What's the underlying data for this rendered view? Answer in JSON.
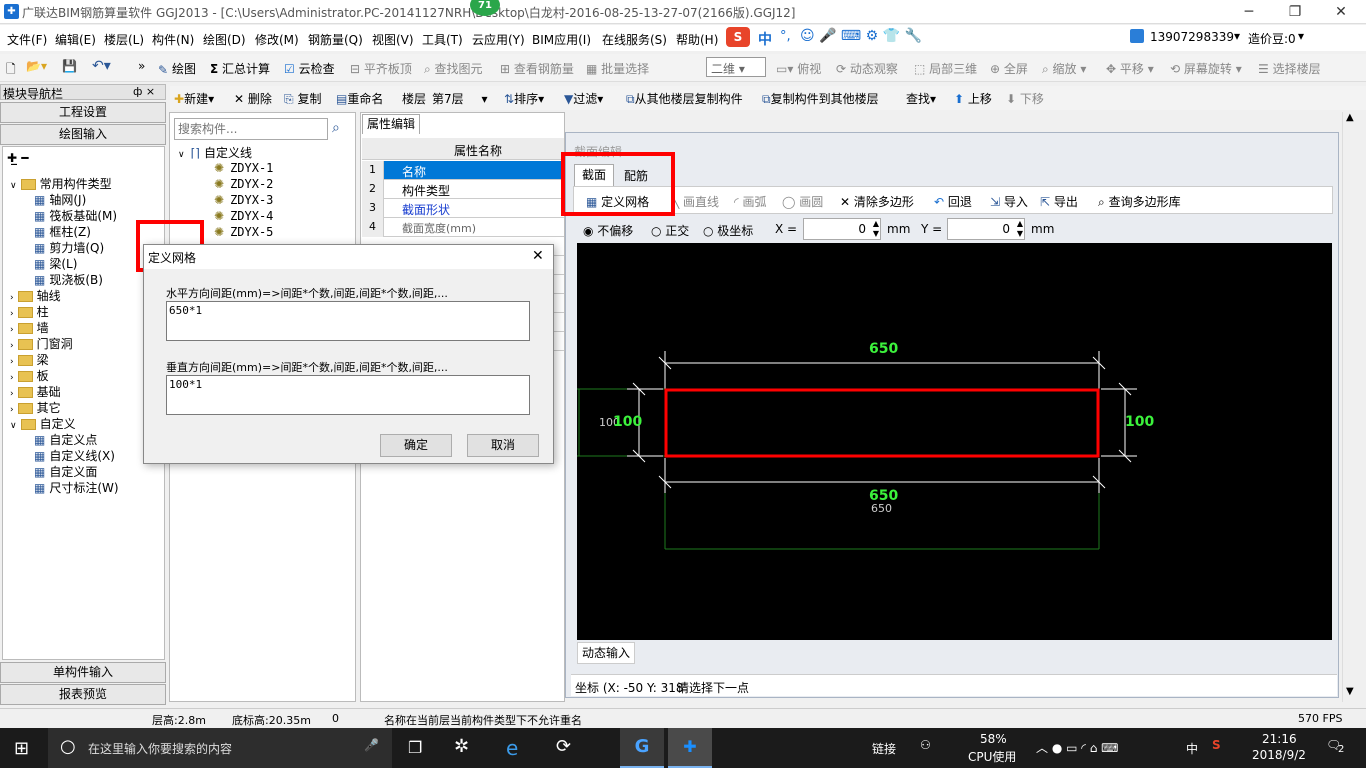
{
  "window": {
    "title": "广联达BIM钢筋算量软件 GGJ2013 - [C:\\Users\\Administrator.PC-20141127NRH\\Desktop\\白龙村-2016-08-25-13-27-07(2166版).GGJ12]",
    "badge": "71",
    "minimize": "─",
    "restore": "❐",
    "close": "✕"
  },
  "menu": [
    "文件(F)",
    "编辑(E)",
    "楼层(L)",
    "构件(N)",
    "绘图(D)",
    "修改(M)",
    "钢筋量(Q)",
    "视图(V)",
    "工具(T)",
    "云应用(Y)",
    "BIM应用(I)",
    "在线服务(S)",
    "帮助(H)"
  ],
  "ime": {
    "lang": "中",
    "extra": "°,"
  },
  "user": {
    "phone": "13907298339",
    "bean": "造价豆:0"
  },
  "toolbar1": {
    "draw": "绘图",
    "sum": "汇总计算",
    "cloud_check": "云检查",
    "flat_top": "平齐板顶",
    "find_elem": "查找图元",
    "view_rebar": "查看钢筋量",
    "batch_select": "批量选择",
    "view_mode": "二维",
    "top_view": "俯视",
    "dynamic_view": "动态观察",
    "local_3d": "局部三维",
    "fullscreen": "全屏",
    "zoom": "缩放",
    "pan": "平移",
    "screen_rotate": "屏幕旋转",
    "select_floor": "选择楼层"
  },
  "toolbar2": {
    "new": "新建",
    "delete": "删除",
    "copy": "复制",
    "rename": "重命名",
    "floor_label": "楼层",
    "floor_value": "第7层",
    "sort": "排序",
    "filter": "过滤",
    "copy_from": "从其他楼层复制构件",
    "copy_to": "复制构件到其他楼层",
    "find": "查找",
    "up": "上移",
    "down": "下移"
  },
  "nav": {
    "title": "模块导航栏",
    "pin": "ф ×",
    "project_settings": "工程设置",
    "draw_input": "绘图输入",
    "single_input": "单构件输入",
    "report_preview": "报表预览",
    "tree": [
      {
        "label": "常用构件类型",
        "level": 1,
        "expanded": true
      },
      {
        "label": "轴网(J)",
        "level": 2
      },
      {
        "label": "筏板基础(M)",
        "level": 2
      },
      {
        "label": "框柱(Z)",
        "level": 2
      },
      {
        "label": "剪力墙(Q)",
        "level": 2
      },
      {
        "label": "梁(L)",
        "level": 2
      },
      {
        "label": "现浇板(B)",
        "level": 2
      },
      {
        "label": "轴线",
        "level": 1
      },
      {
        "label": "柱",
        "level": 1
      },
      {
        "label": "墙",
        "level": 1
      },
      {
        "label": "门窗洞",
        "level": 1
      },
      {
        "label": "梁",
        "level": 1
      },
      {
        "label": "板",
        "level": 1
      },
      {
        "label": "基础",
        "level": 1
      },
      {
        "label": "其它",
        "level": 1
      },
      {
        "label": "自定义",
        "level": 1,
        "expanded": true
      },
      {
        "label": "自定义点",
        "level": 2
      },
      {
        "label": "自定义线(X)",
        "level": 2
      },
      {
        "label": "自定义面",
        "level": 2
      },
      {
        "label": "尺寸标注(W)",
        "level": 2
      }
    ]
  },
  "components": {
    "search_placeholder": "搜索构件...",
    "root": "自定义线",
    "items": [
      "ZDYX-1",
      "ZDYX-2",
      "ZDYX-3",
      "ZDYX-4",
      "ZDYX-5"
    ]
  },
  "props": {
    "tab": "属性编辑",
    "header": "属性名称",
    "rows": [
      {
        "n": "1",
        "v": "名称"
      },
      {
        "n": "2",
        "v": "构件类型"
      },
      {
        "n": "3",
        "v": "截面形状"
      },
      {
        "n": "4",
        "v": "截面宽度(mm)"
      }
    ]
  },
  "section": {
    "title": "截面编辑",
    "tabs": [
      "截面",
      "配筋"
    ],
    "tools": {
      "grid": "定义网格",
      "line": "画直线",
      "arc": "画弧",
      "circle": "画圆",
      "clear": "清除多边形",
      "undo": "回退",
      "import": "导入",
      "export": "导出",
      "library": "查询多边形库"
    },
    "coord": {
      "no_offset": "不偏移",
      "ortho": "正交",
      "polar": "极坐标",
      "x_label": "X =",
      "x_value": "0",
      "y_label": "Y =",
      "y_value": "0",
      "unit": "mm"
    },
    "dims": {
      "top": "650",
      "bottom": "650",
      "bottom_small": "650",
      "left": "100",
      "left_small": "100",
      "right": "100"
    },
    "dynamic_input": "动态输入",
    "coord_label": "坐标 (X: -50 Y: 318",
    "hint": "请选择下一点"
  },
  "dialog": {
    "title": "定义网格",
    "h_label": "水平方向间距(mm)=>间距*个数,间距,间距*个数,间距,...",
    "h_value": "650*1",
    "v_label": "垂直方向间距(mm)=>间距*个数,间距,间距*个数,间距,...",
    "v_value": "100*1",
    "ok": "确定",
    "cancel": "取消",
    "close": "✕"
  },
  "status": {
    "floor_height": "层高:2.8m",
    "base_height": "底标高:20.35m",
    "zero": "0",
    "msg": "名称在当前层当前构件类型下不允许重名",
    "fps": "570 FPS"
  },
  "taskbar": {
    "search": "在这里输入你要搜索的内容",
    "link": "链接",
    "cpu_pct": "58%",
    "cpu_label": "CPU使用",
    "ime": "中",
    "time": "21:16",
    "date": "2018/9/2",
    "notify": "2"
  },
  "colors": {
    "accent": "#0078d7",
    "red": "#ff0000",
    "green": "#00ff00",
    "canvas": "#000000"
  }
}
